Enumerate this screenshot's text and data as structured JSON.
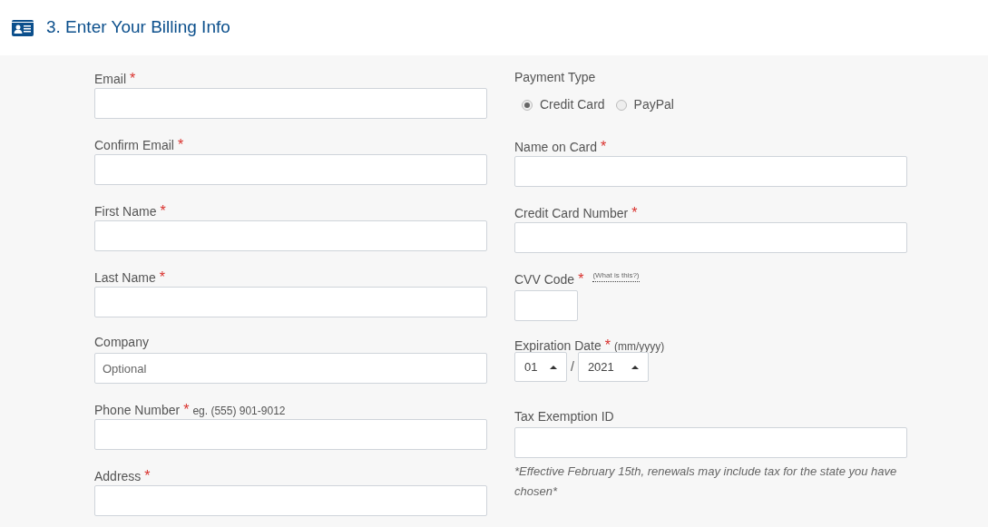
{
  "header": {
    "title": "3. Enter Your Billing Info"
  },
  "left_fields": [
    {
      "label": "Email",
      "required_mark": "*"
    },
    {
      "label": "Confirm Email",
      "required_mark": "*"
    },
    {
      "label": "First Name",
      "required_mark": "*"
    },
    {
      "label": "Last Name",
      "required_mark": "*"
    },
    {
      "label": "Company",
      "placeholder": "Optional"
    },
    {
      "label": "Phone Number",
      "required_mark": "*",
      "hint": "eg. (555) 901-9012"
    },
    {
      "label": "Address",
      "required_mark": "*"
    }
  ],
  "right_fields": [
    {
      "kind": "radio-group",
      "label": "Payment Type",
      "options": [
        {
          "label": "Credit Card",
          "selected": true
        },
        {
          "label": "PayPal",
          "selected": false
        }
      ]
    },
    {
      "kind": "text",
      "label": "Name on Card",
      "required_mark": "*"
    },
    {
      "kind": "text",
      "label": "Credit Card Number",
      "required_mark": "*"
    },
    {
      "kind": "cvv",
      "label": "CVV Code",
      "required_mark": "*",
      "link": "(What is this?)"
    },
    {
      "kind": "expiry",
      "label": "Expiration Date",
      "required_mark": "*",
      "hint": "(mm/yyyy)",
      "month": "01",
      "separator": "/",
      "year": "2021"
    },
    {
      "kind": "text",
      "label": "Tax Exemption ID",
      "note": "*Effective February 15th, renewals may include tax for the state you have chosen*"
    }
  ]
}
